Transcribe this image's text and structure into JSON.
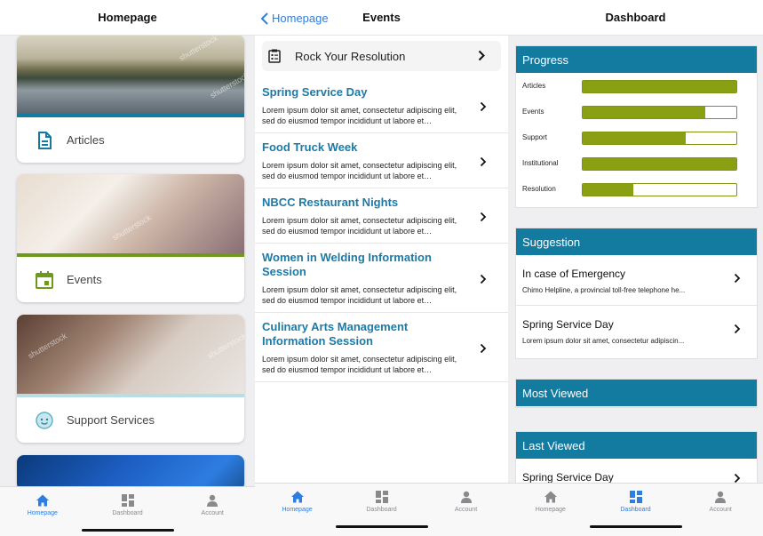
{
  "homepage": {
    "title": "Homepage",
    "cards": [
      {
        "label": "Articles"
      },
      {
        "label": "Events"
      },
      {
        "label": "Support Services"
      }
    ],
    "watermark": "shutterstock"
  },
  "events": {
    "back_label": "Homepage",
    "title": "Events",
    "featured": "Rock Your Resolution",
    "items": [
      {
        "title": "Spring Service Day",
        "desc": "Lorem ipsum dolor sit amet, consectetur adipiscing elit, sed do eiusmod tempor incididunt ut labore et…"
      },
      {
        "title": "Food Truck Week",
        "desc": "Lorem ipsum dolor sit amet, consectetur adipiscing elit, sed do eiusmod tempor incididunt ut labore et…"
      },
      {
        "title": "NBCC Restaurant Nights",
        "desc": "Lorem ipsum dolor sit amet, consectetur adipiscing elit, sed do eiusmod tempor incididunt ut labore et…"
      },
      {
        "title": "Women in Welding Information Session",
        "desc": "Lorem ipsum dolor sit amet, consectetur adipiscing elit, sed do eiusmod tempor incididunt ut labore et…"
      },
      {
        "title": "Culinary Arts Management Information Session",
        "desc": "Lorem ipsum dolor sit amet, consectetur adipiscing elit, sed do eiusmod tempor incididunt ut labore et…"
      }
    ]
  },
  "dashboard": {
    "title": "Dashboard",
    "progress": {
      "header": "Progress",
      "rows": [
        {
          "label": "Articles",
          "value": 1.0
        },
        {
          "label": "Events",
          "value": 0.8
        },
        {
          "label": "Support",
          "value": 0.67
        },
        {
          "label": "Institutional",
          "value": 1.0
        },
        {
          "label": "Resolution",
          "value": 0.33
        }
      ]
    },
    "suggestion": {
      "header": "Suggestion",
      "items": [
        {
          "title": "In case of Emergency",
          "desc": "Chimo Helpline, a provincial toll-free telephone he..."
        },
        {
          "title": "Spring Service Day",
          "desc": "Lorem ipsum dolor sit amet, consectetur adipiscin..."
        }
      ]
    },
    "most_viewed": {
      "header": "Most Viewed"
    },
    "last_viewed": {
      "header": "Last Viewed",
      "items": [
        {
          "title": "Spring Service Day"
        }
      ]
    }
  },
  "tabbar": {
    "tabs": [
      "Homepage",
      "Dashboard",
      "Account"
    ]
  },
  "colors": {
    "accent_blue": "#2f7ddf",
    "header_teal": "#137aa0",
    "title_blue": "#1c7aa6",
    "progress_green": "#8a9f12",
    "articles_strip": "#137aa0",
    "events_strip": "#6d9a1a",
    "support_strip": "#b7dde6"
  }
}
